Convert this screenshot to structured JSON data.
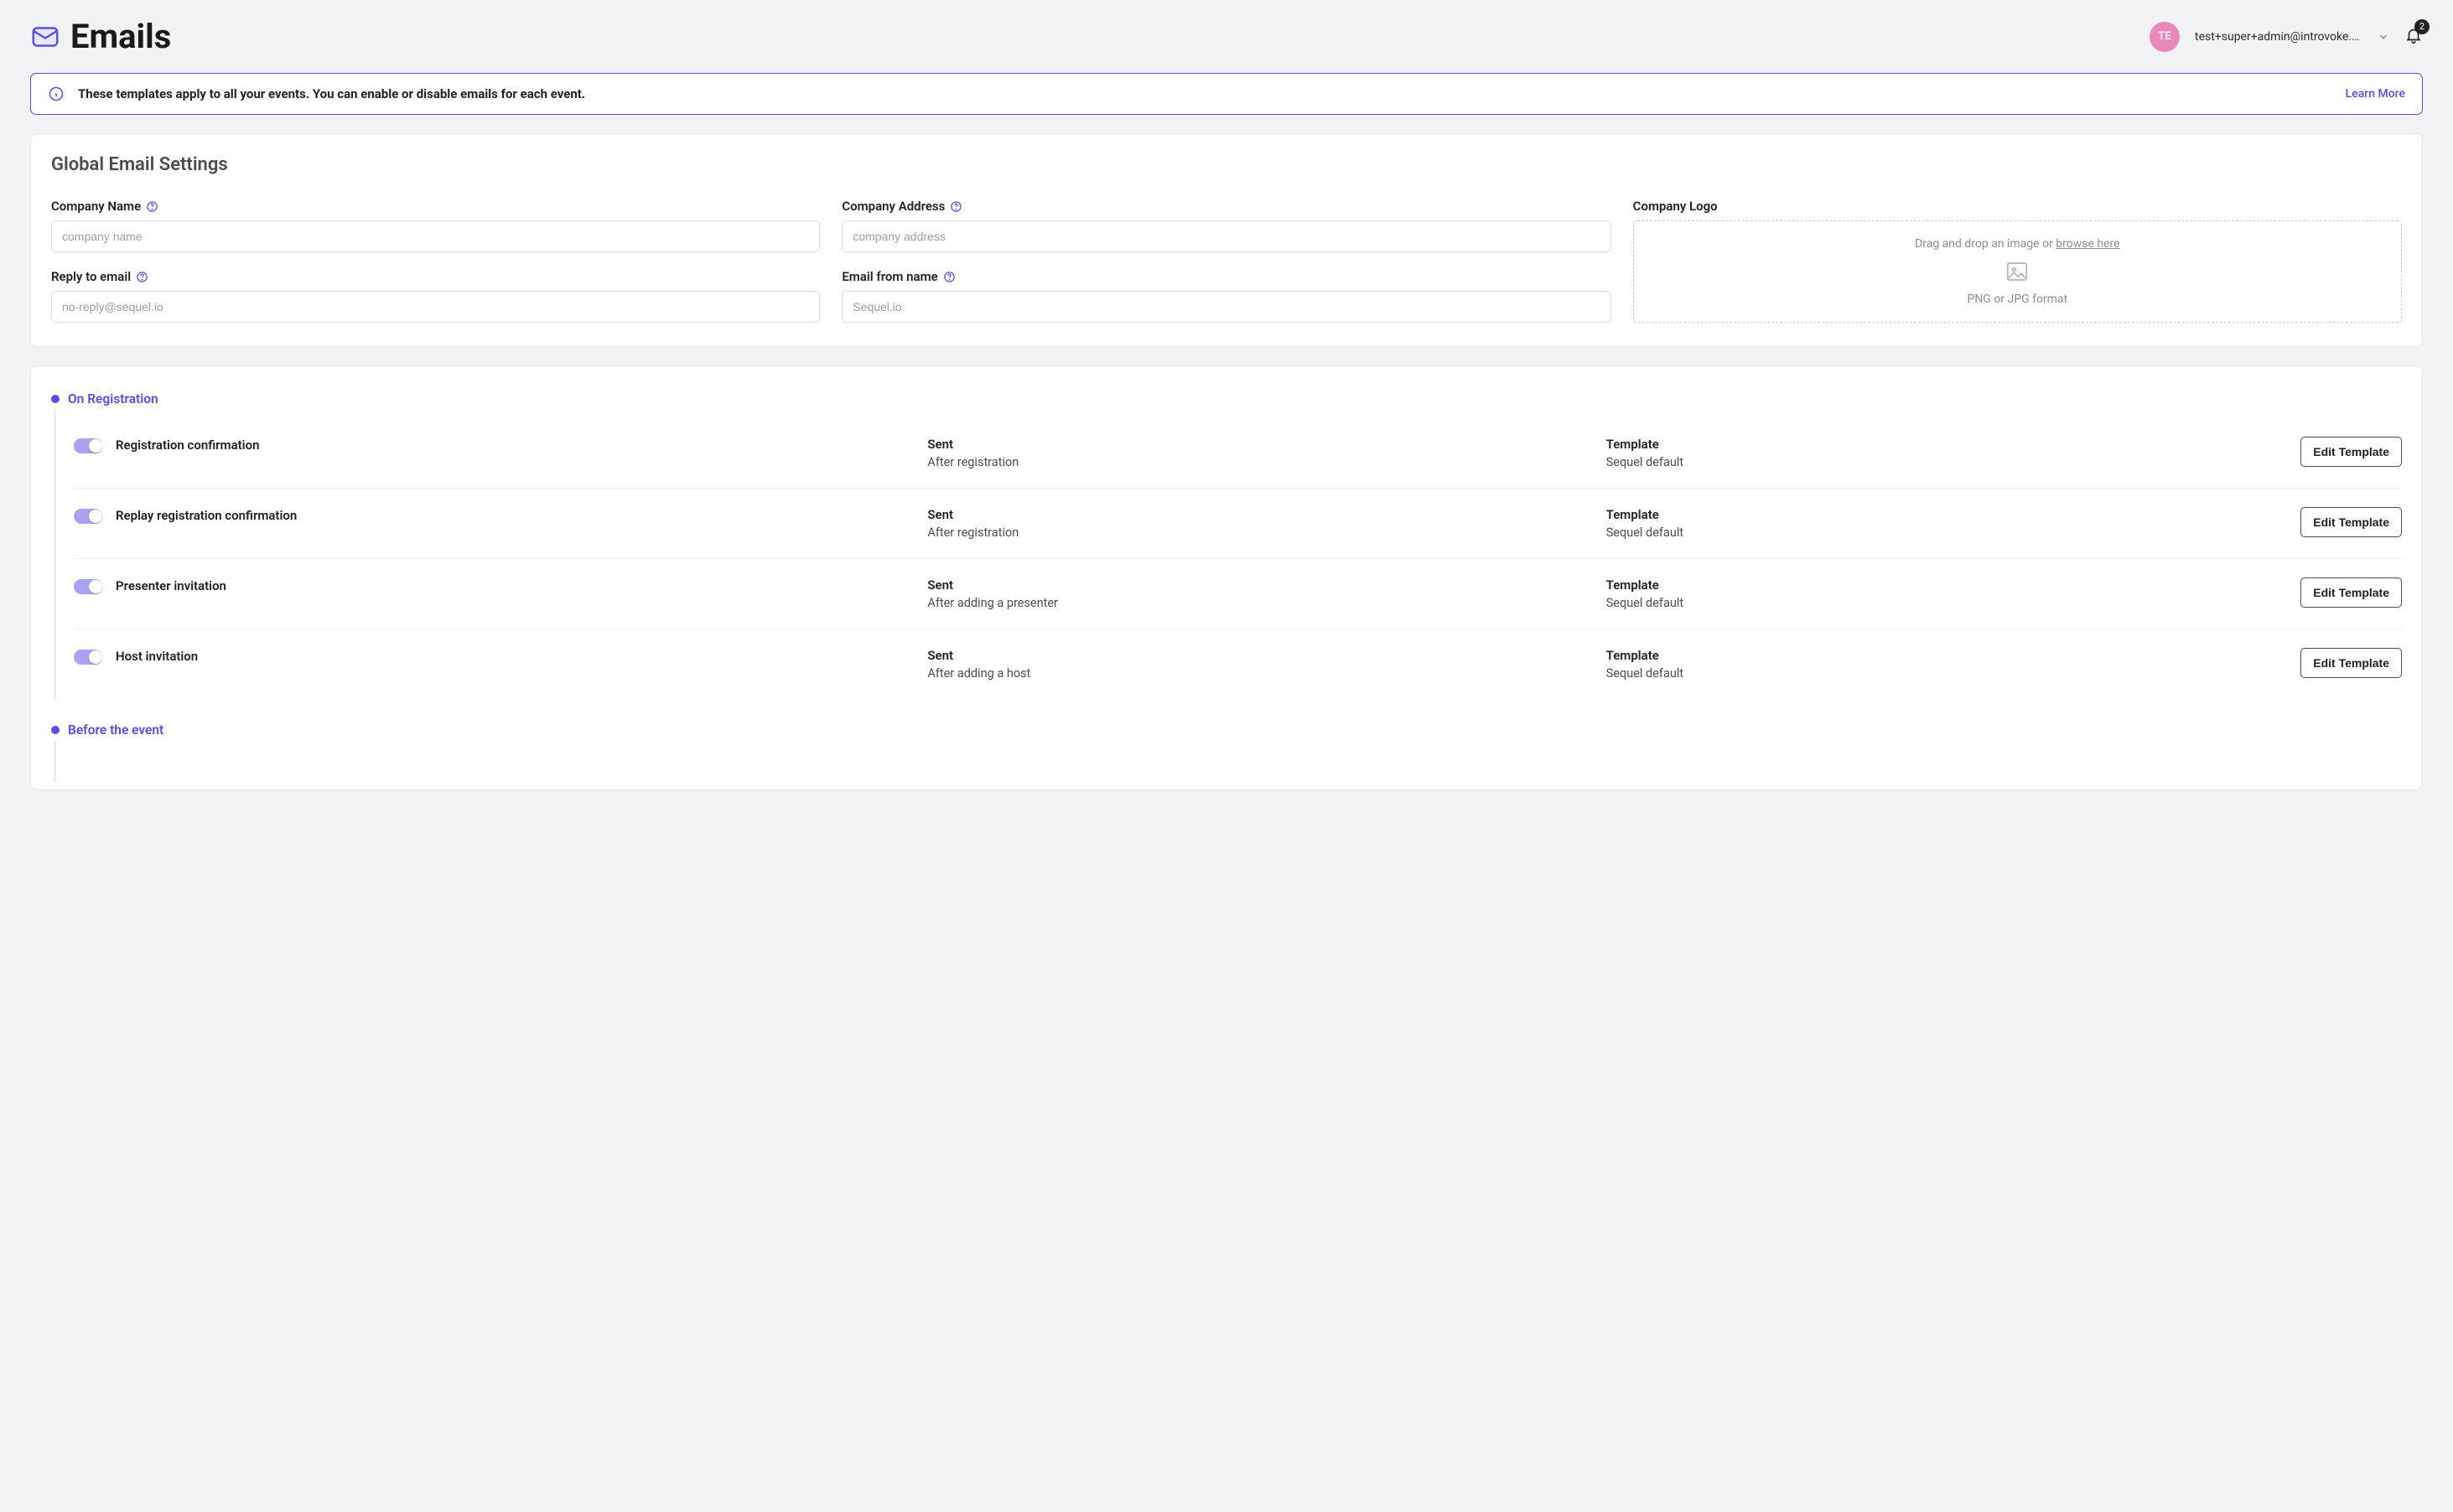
{
  "header": {
    "title": "Emails",
    "user_email": "test+super+admin@introvoke.c…",
    "avatar_initials": "TE",
    "notifications_count": "2"
  },
  "banner": {
    "text": "These templates apply to all your events. You can enable or disable emails for each event.",
    "learn_more": "Learn More"
  },
  "global": {
    "title": "Global Email Settings",
    "company_name_label": "Company Name",
    "company_name_placeholder": "company name",
    "company_address_label": "Company Address",
    "company_address_placeholder": "company address",
    "company_logo_label": "Company Logo",
    "logo_prompt_prefix": "Drag and drop an image or ",
    "logo_browse": "browse here",
    "logo_format": "PNG or JPG format",
    "reply_to_label": "Reply to email",
    "reply_to_placeholder": "no-reply@sequel.io",
    "from_name_label": "Email from name",
    "from_name_placeholder": "Sequel.io"
  },
  "columns": {
    "sent": "Sent",
    "template": "Template",
    "edit": "Edit Template"
  },
  "sections": [
    {
      "title": "On Registration",
      "items": [
        {
          "name": "Registration confirmation",
          "sent": "After registration",
          "template": "Sequel default"
        },
        {
          "name": "Replay registration confirmation",
          "sent": "After registration",
          "template": "Sequel default"
        },
        {
          "name": "Presenter invitation",
          "sent": "After adding a presenter",
          "template": "Sequel default"
        },
        {
          "name": "Host invitation",
          "sent": "After adding a host",
          "template": "Sequel default"
        }
      ]
    },
    {
      "title": "Before the event",
      "items": []
    }
  ]
}
